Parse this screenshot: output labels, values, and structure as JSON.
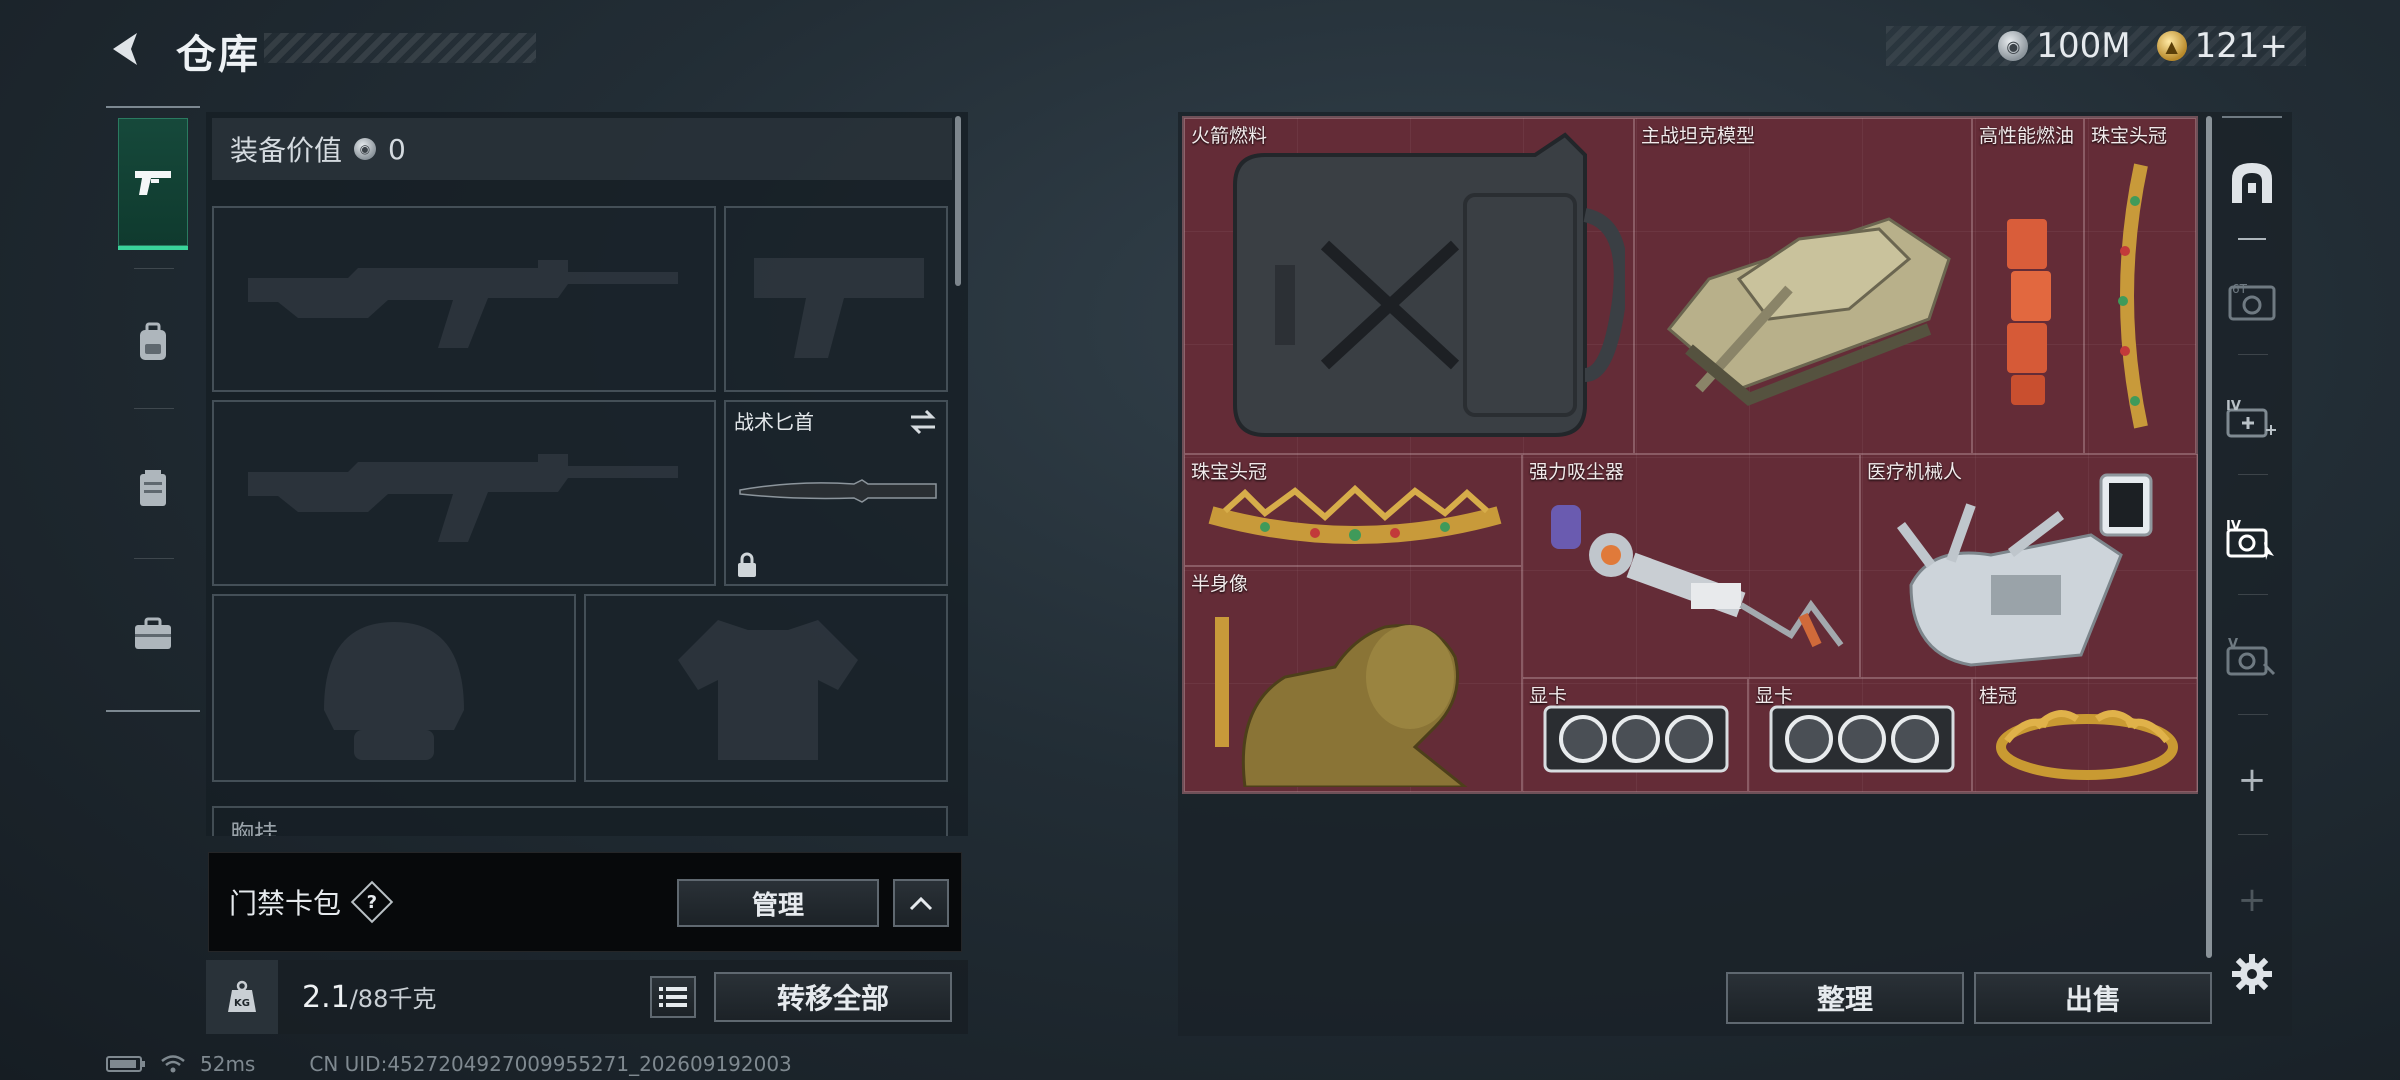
{
  "header": {
    "title": "仓库",
    "currencies": [
      {
        "icon": "silver-coin-icon",
        "value": "100M"
      },
      {
        "icon": "gold-coin-icon",
        "value": "121+"
      }
    ]
  },
  "equipment": {
    "value_label": "装备价值",
    "value_icon": "silver-coin-icon",
    "value": "0",
    "slots": {
      "primary_weapon_1": {
        "icon": "assault-rifle-icon"
      },
      "pistol": {
        "icon": "pistol-icon"
      },
      "primary_weapon_2": {
        "icon": "assault-rifle-icon"
      },
      "melee": {
        "label": "战术匕首",
        "icon": "knife-icon",
        "locked": true
      },
      "helmet": {
        "icon": "helmet-icon"
      },
      "armor": {
        "icon": "body-armor-icon"
      }
    },
    "chest_rig_label": "胸挂",
    "keycard": {
      "label": "门禁卡包",
      "help": "?",
      "manage": "管理"
    },
    "weight": {
      "icon_text": "KG",
      "current": "2.1",
      "max": "/88千克"
    },
    "transfer_all": "转移全部"
  },
  "side_tabs": [
    {
      "icon": "pistol-icon",
      "active": true
    },
    {
      "icon": "backpack-icon",
      "active": false
    },
    {
      "icon": "vest-icon",
      "active": false
    },
    {
      "icon": "briefcase-icon",
      "active": false
    }
  ],
  "stash": {
    "items": [
      {
        "name": "火箭燃料",
        "icon": "jerrycan-icon"
      },
      {
        "name": "主战坦克模型",
        "icon": "tank-model-icon"
      },
      {
        "name": "高性能燃油",
        "icon": "fuel-cells-icon"
      },
      {
        "name": "珠宝头冠",
        "icon": "jeweled-crown-icon"
      },
      {
        "name": "珠宝头冠",
        "icon": "jeweled-tiara-icon"
      },
      {
        "name": "强力吸尘器",
        "icon": "vacuum-cleaner-icon"
      },
      {
        "name": "医疗机械人",
        "icon": "medical-robot-icon"
      },
      {
        "name": "半身像",
        "icon": "bust-statue-icon"
      },
      {
        "name": "显卡",
        "icon": "graphics-card-icon"
      },
      {
        "name": "显卡",
        "icon": "graphics-card-icon"
      },
      {
        "name": "桂冠",
        "icon": "laurel-wreath-icon"
      }
    ],
    "tabs": [
      {
        "icon": "stash-home-icon",
        "label": ""
      },
      {
        "icon": "stash-tab-6-icon",
        "label": "6T"
      },
      {
        "icon": "stash-tab-iv-plus-icon",
        "label": "IV"
      },
      {
        "icon": "stash-tab-iv-icon",
        "label": "IV"
      },
      {
        "icon": "stash-tab-v-icon",
        "label": "V"
      },
      {
        "icon": "add-tab-icon",
        "label": "+"
      },
      {
        "icon": "add-tab-icon",
        "label": "+"
      }
    ],
    "sort": "整理",
    "sell": "出售"
  },
  "status": {
    "ping": "52ms",
    "uid": "CN UID:4527204927009955271_202609192003"
  }
}
